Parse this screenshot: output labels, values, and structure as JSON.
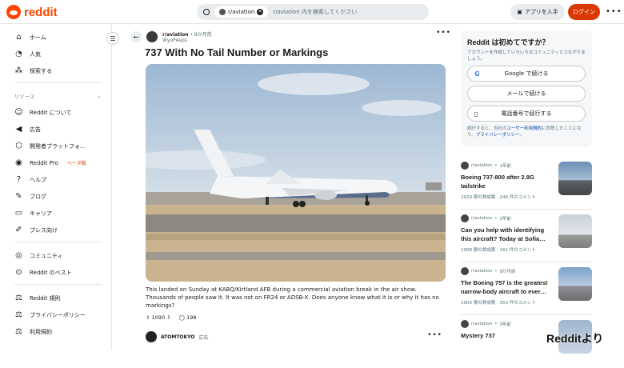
{
  "header": {
    "brand": "reddit",
    "search_chip": "r/aviation",
    "search_placeholder": "r/aviation 内を検索してください",
    "app_button": "アプリを入手",
    "login_button": "ログイン"
  },
  "sidebar": {
    "items": [
      {
        "label": "ホーム",
        "icon": "home-icon"
      },
      {
        "label": "人気",
        "icon": "trending-icon"
      },
      {
        "label": "探索する",
        "icon": "explore-icon"
      }
    ],
    "resources_label": "リソース",
    "resources": [
      {
        "label": "Reddit について",
        "icon": "reddit-icon"
      },
      {
        "label": "広告",
        "icon": "megaphone-icon"
      },
      {
        "label": "開発者プラットフォ…",
        "icon": "code-icon"
      },
      {
        "label": "Reddit Pro",
        "badge": "ベータ版",
        "icon": "pro-icon"
      },
      {
        "label": "ヘルプ",
        "icon": "help-icon"
      },
      {
        "label": "ブログ",
        "icon": "blog-icon"
      },
      {
        "label": "キャリア",
        "icon": "briefcase-icon"
      },
      {
        "label": "プレス向け",
        "icon": "mic-icon"
      }
    ],
    "community": [
      {
        "label": "コミュニティ",
        "icon": "community-icon"
      },
      {
        "label": "Reddit のベスト",
        "icon": "best-icon"
      }
    ],
    "legal": [
      {
        "label": "Reddit 規則",
        "icon": "rules-icon"
      },
      {
        "label": "プライバシーポリシー",
        "icon": "privacy-icon"
      },
      {
        "label": "利用規約",
        "icon": "terms-icon"
      }
    ]
  },
  "post": {
    "subreddit": "r/aviation",
    "time": "8か月前",
    "author": "WyoPeeps",
    "title": "737 With No Tail Number or Markings",
    "body": "This landed on Sunday at KABQ/Kirtland AFB during a commercial aviation break in the air show. Thousands of people saw it. It was not on FR24 or ADSB-X. Does anyone know what it is or why it has no markings?",
    "votes": "1090",
    "comments": "198"
  },
  "ad": {
    "name": "ATOMTOKYO",
    "tag": "広告"
  },
  "signup": {
    "title": "Reddit は初めてですか？",
    "desc": "アカウントを作成していろいろなコミュニティとつながりましょう。",
    "google": "Google で続ける",
    "email": "メールで続ける",
    "phone": "電話番号で続行する",
    "terms_pre": "続行すると、当社の",
    "terms_link1": "ユーザー利用規約",
    "terms_mid": "に同意したことになり、",
    "terms_link2": "プライバシーポリシー",
    "terms_post": "。"
  },
  "related": [
    {
      "sub": "r/aviation",
      "time": "1年前",
      "title": "Boeing 737-800 after 2.8G tailstrike",
      "stats": "2929 票の賛成票 · 246 件のコメント"
    },
    {
      "sub": "r/aviation",
      "time": "2年前",
      "title": "Can you help with identifying this aircraft? Today at Sofia…",
      "stats": "1908 票の賛成票 · 161 件のコメント"
    },
    {
      "sub": "r/aviation",
      "time": "9か月前",
      "title": "The Boeing 757 is the greatest narrow-body aircraft to ever…",
      "stats": "1903 票の賛成票 · 353 件のコメント"
    },
    {
      "sub": "r/aviation",
      "time": "3年前",
      "title": "Mystery 737",
      "stats": ""
    }
  ],
  "watermark": "Redditより"
}
